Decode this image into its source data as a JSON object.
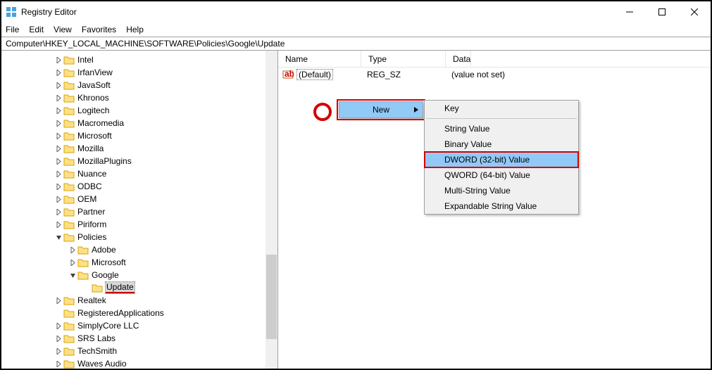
{
  "title": "Registry Editor",
  "menu": {
    "file": "File",
    "edit": "Edit",
    "view": "View",
    "favorites": "Favorites",
    "help": "Help"
  },
  "address": "Computer\\HKEY_LOCAL_MACHINE\\SOFTWARE\\Policies\\Google\\Update",
  "tree": {
    "items": [
      {
        "label": "Intel",
        "indent": 74,
        "tw": "r"
      },
      {
        "label": "IrfanView",
        "indent": 74,
        "tw": "r"
      },
      {
        "label": "JavaSoft",
        "indent": 74,
        "tw": "r"
      },
      {
        "label": "Khronos",
        "indent": 74,
        "tw": "r"
      },
      {
        "label": "Logitech",
        "indent": 74,
        "tw": "r"
      },
      {
        "label": "Macromedia",
        "indent": 74,
        "tw": "r"
      },
      {
        "label": "Microsoft",
        "indent": 74,
        "tw": "r"
      },
      {
        "label": "Mozilla",
        "indent": 74,
        "tw": "r"
      },
      {
        "label": "MozillaPlugins",
        "indent": 74,
        "tw": "r"
      },
      {
        "label": "Nuance",
        "indent": 74,
        "tw": "r"
      },
      {
        "label": "ODBC",
        "indent": 74,
        "tw": "r"
      },
      {
        "label": "OEM",
        "indent": 74,
        "tw": "r"
      },
      {
        "label": "Partner",
        "indent": 74,
        "tw": "r"
      },
      {
        "label": "Piriform",
        "indent": 74,
        "tw": "r"
      },
      {
        "label": "Policies",
        "indent": 74,
        "tw": "d"
      },
      {
        "label": "Adobe",
        "indent": 94,
        "tw": "r"
      },
      {
        "label": "Microsoft",
        "indent": 94,
        "tw": "r"
      },
      {
        "label": "Google",
        "indent": 94,
        "tw": "d"
      },
      {
        "label": "Update",
        "indent": 114,
        "tw": "",
        "selected": true
      },
      {
        "label": "Realtek",
        "indent": 74,
        "tw": "r"
      },
      {
        "label": "RegisteredApplications",
        "indent": 74,
        "tw": ""
      },
      {
        "label": "SimplyCore LLC",
        "indent": 74,
        "tw": "r"
      },
      {
        "label": "SRS Labs",
        "indent": 74,
        "tw": "r"
      },
      {
        "label": "TechSmith",
        "indent": 74,
        "tw": "r"
      },
      {
        "label": "Waves Audio",
        "indent": 74,
        "tw": "r"
      }
    ]
  },
  "columns": {
    "name": "Name",
    "type": "Type",
    "data": "Data"
  },
  "row0": {
    "name": "(Default)",
    "type": "REG_SZ",
    "data": "(value not set)"
  },
  "ctx": {
    "new": "New"
  },
  "sub": {
    "key": "Key",
    "string": "String Value",
    "binary": "Binary Value",
    "dword": "DWORD (32-bit) Value",
    "qword": "QWORD (64-bit) Value",
    "multi": "Multi-String Value",
    "expand": "Expandable String Value"
  }
}
